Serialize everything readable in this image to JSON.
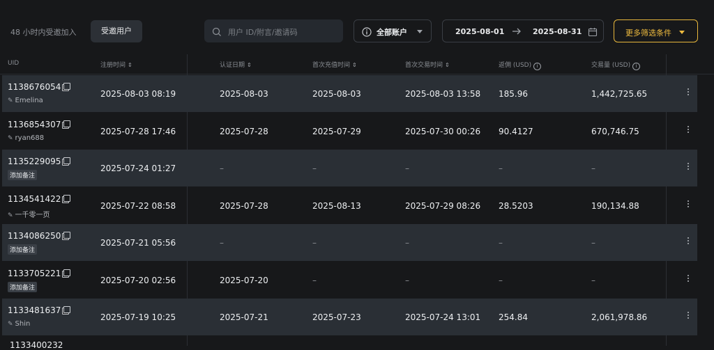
{
  "toolbar": {
    "invite_label": "48 小时内受邀加入",
    "invite_button": "受邀用户",
    "search_placeholder": "用户 ID/附言/邀请码",
    "account_select": "全部账户",
    "date_from": "2025-08-01",
    "date_to": "2025-08-31",
    "more_filters": "更多筛选条件"
  },
  "table": {
    "headers": {
      "uid": "UID",
      "register_time": "注册时间",
      "verify_date": "认证日期",
      "first_deposit": "首次充值时间",
      "first_trade": "首次交易时间",
      "rebate": "返佣 (USD)",
      "volume": "交易量 (USD)"
    },
    "rows": [
      {
        "uid": "1138676054",
        "note": "Emelina",
        "note_type": "name",
        "register_time": "2025-08-03 08:19",
        "verify_date": "2025-08-03",
        "first_deposit": "2025-08-03",
        "first_trade": "2025-08-03 13:58",
        "rebate": "185.96",
        "volume": "1,442,725.65"
      },
      {
        "uid": "1136854307",
        "note": "ryan688",
        "note_type": "name",
        "register_time": "2025-07-28 17:46",
        "verify_date": "2025-07-28",
        "first_deposit": "2025-07-29",
        "first_trade": "2025-07-30 00:26",
        "rebate": "90.4127",
        "volume": "670,746.75"
      },
      {
        "uid": "1135229095",
        "note": "添加备注",
        "note_type": "tag",
        "register_time": "2025-07-24 01:27",
        "verify_date": "–",
        "first_deposit": "–",
        "first_trade": "–",
        "rebate": "–",
        "volume": "–"
      },
      {
        "uid": "1134541422",
        "note": "一千零一页",
        "note_type": "name",
        "register_time": "2025-07-22 08:58",
        "verify_date": "2025-07-28",
        "first_deposit": "2025-08-13",
        "first_trade": "2025-07-29 08:26",
        "rebate": "28.5203",
        "volume": "190,134.88"
      },
      {
        "uid": "1134086250",
        "note": "添加备注",
        "note_type": "tag",
        "register_time": "2025-07-21 05:56",
        "verify_date": "–",
        "first_deposit": "–",
        "first_trade": "–",
        "rebate": "–",
        "volume": "–"
      },
      {
        "uid": "1133705221",
        "note": "添加备注",
        "note_type": "tag",
        "register_time": "2025-07-20 02:56",
        "verify_date": "2025-07-20",
        "first_deposit": "–",
        "first_trade": "–",
        "rebate": "–",
        "volume": "–"
      },
      {
        "uid": "1133481637",
        "note": "Shin",
        "note_type": "name",
        "register_time": "2025-07-19 10:25",
        "verify_date": "2025-07-21",
        "first_deposit": "2025-07-23",
        "first_trade": "2025-07-24 13:01",
        "rebate": "254.84",
        "volume": "2,061,978.86"
      }
    ],
    "partial_row_uid": "1133400232"
  },
  "colors": {
    "accent": "#f0bc3f",
    "row_alt": "#2a2f35",
    "background": "#17181a"
  }
}
